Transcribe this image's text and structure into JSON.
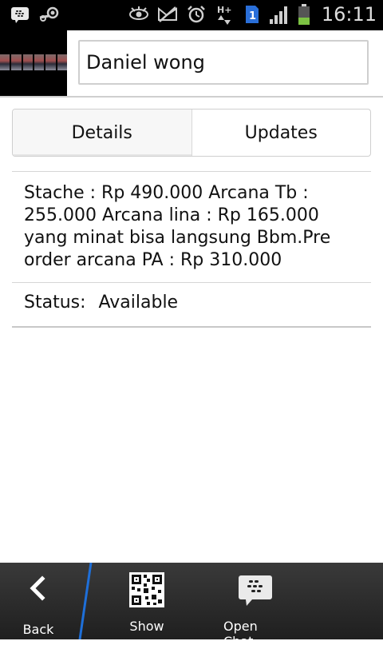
{
  "status_bar": {
    "time": "16:11",
    "sim_badge": "1",
    "network": "H+"
  },
  "contact": {
    "name": "Daniel wong"
  },
  "tabs": [
    {
      "label": "Details",
      "active": true
    },
    {
      "label": "Updates",
      "active": false
    }
  ],
  "details": {
    "message": "Stache : Rp 490.000 Arcana Tb : 255.000 Arcana lina : Rp 165.000 yang minat bisa langsung Bbm.Pre order arcana PA : Rp 310.000",
    "status_label": "Status:",
    "status_value": "Available"
  },
  "bottom_bar": {
    "back_label": "Back",
    "show_label": "Show",
    "open_chat_label": "Open Chat"
  },
  "colors": {
    "divider": "#d6d6d6",
    "bottom_bar": "#2a2a2a",
    "accent_blue": "#1e6fd9",
    "battery_green": "#7cc243"
  },
  "icons": [
    "bbm-icon",
    "steam-icon",
    "eye-icon",
    "muted-notif-icon",
    "alarm-icon",
    "data-icon",
    "sim-icon",
    "signal-icon",
    "battery-icon",
    "back-chevron-icon",
    "qr-icon",
    "chat-bubble-icon"
  ]
}
